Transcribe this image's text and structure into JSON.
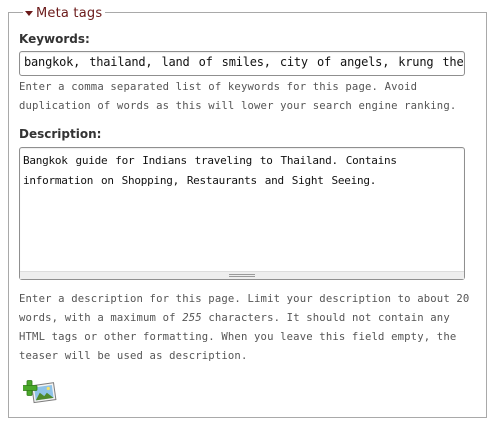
{
  "fieldset": {
    "legend": "Meta tags"
  },
  "keywords": {
    "label": "Keywords:",
    "value": "bangkok, thailand, land of smiles, city of angels, krung thep",
    "help": "Enter a comma separated list of keywords for this page. Avoid duplication of words as this will lower your search engine ranking."
  },
  "description": {
    "label": "Description:",
    "value": "Bangkok guide for Indians traveling to Thailand. Contains information on Shopping, Restaurants and Sight Seeing.",
    "help_before": "Enter a description for this page. Limit your description to about 20 words, with a maximum of ",
    "help_max": "255",
    "help_after": " characters. It should not contain any HTML tags or other formatting. When you leave this field empty, the teaser will be used as description."
  },
  "icons": {
    "legend_toggle": "chevron-down-icon",
    "add_image": "add-image-icon",
    "resize": "resize-grip-icon"
  },
  "colors": {
    "legend": "#6b1a1a",
    "border": "#a9a9a9",
    "help_text": "#555555"
  }
}
